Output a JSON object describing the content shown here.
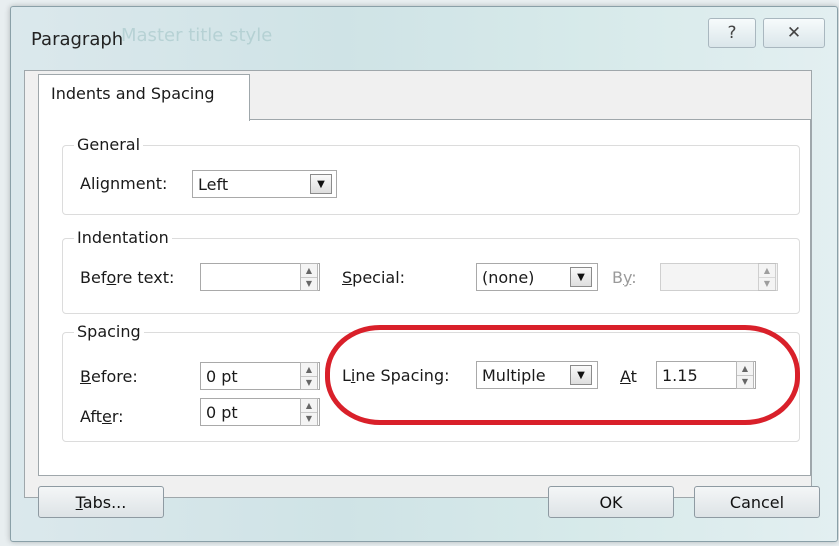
{
  "window": {
    "title": "Paragraph",
    "ghost_title": "Master title style",
    "help_label": "?",
    "close_label": "✕"
  },
  "tab": {
    "label": "Indents and Spacing"
  },
  "general": {
    "heading": "General",
    "alignment_label": "Alignment:",
    "alignment_value": "Left"
  },
  "indentation": {
    "heading": "Indentation",
    "before_text_label": "Before text:",
    "before_text_value": "",
    "special_label": "Special:",
    "special_value": "(none)",
    "by_label": "By:",
    "by_value": ""
  },
  "spacing": {
    "heading": "Spacing",
    "before_label": "Before:",
    "before_value": "0 pt",
    "after_label": "After:",
    "after_value": "0 pt",
    "line_spacing_label": "Line Spacing:",
    "line_spacing_value": "Multiple",
    "at_label": "At",
    "at_value": "1.15"
  },
  "buttons": {
    "tabs": "Tabs...",
    "ok": "OK",
    "cancel": "Cancel"
  },
  "annotation": {
    "color": "#d9202a"
  }
}
